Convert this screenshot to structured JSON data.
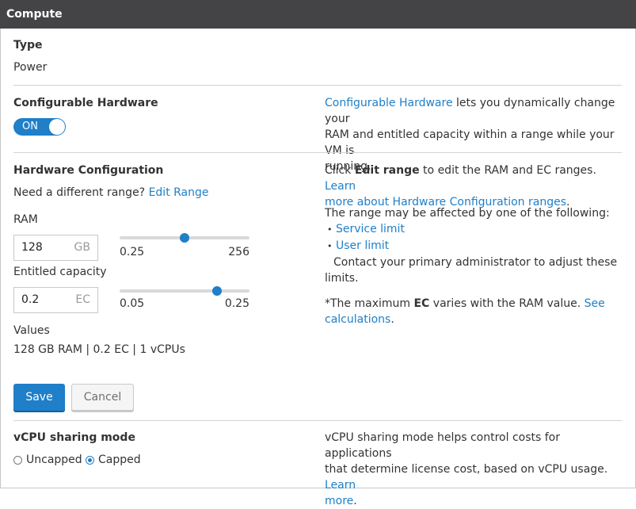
{
  "header": {
    "title": "Compute"
  },
  "type_section": {
    "label": "Type",
    "value": "Power"
  },
  "configurable": {
    "label": "Configurable Hardware",
    "toggle_label": "ON",
    "toggle_on": true,
    "desc_link": "Configurable Hardware",
    "desc_line1": " lets you dynamically change your",
    "desc_line2": "RAM and entitled capacity within a range while your VM is",
    "desc_line3": "running."
  },
  "hardware": {
    "label": "Hardware Configuration",
    "need_text": "Need a different range?",
    "edit_link": "Edit Range",
    "ram_label": "RAM",
    "ram_value": "128",
    "ram_unit": "GB",
    "ram_min": "0.25",
    "ram_max": "256",
    "ram_slider_fraction": 0.5,
    "ec_label": "Entitled capacity",
    "ec_value": "0.2",
    "ec_unit": "EC",
    "ec_min": "0.05",
    "ec_max": "0.25",
    "ec_slider_fraction": 0.75,
    "values_label": "Values",
    "values_text": "128 GB RAM | 0.2 EC | 1 vCPUs",
    "help": {
      "click_text": "Click ",
      "edit_range_bold": "Edit range",
      "click_rest": " to edit the RAM and EC ranges. ",
      "learn_link_1": "Learn",
      "learn_link_2": "more about Hardware Configuration ranges",
      "period": ".",
      "range_text": "The range may be affected by one of the following:",
      "bullet": "•",
      "service_limit": "Service limit",
      "user_limit": "User limit",
      "contact_line1": "Contact your primary administrator to adjust these",
      "contact_line2": "limits.",
      "max_text": "*The maximum ",
      "max_bold": "EC",
      "max_rest": " varies with the RAM value. ",
      "see_link": "See",
      "calc_link": "calculations",
      "calc_period": "."
    }
  },
  "actions": {
    "save": "Save",
    "cancel": "Cancel"
  },
  "vcpu": {
    "label": "vCPU sharing mode",
    "options": [
      "Uncapped",
      "Capped"
    ],
    "selected": "Capped",
    "desc_line1": "vCPU sharing mode helps control costs for applications",
    "desc_line2a": "that determine license cost, based on vCPU usage. ",
    "learn_link_1": "Learn",
    "learn_link_2": "more",
    "period": "."
  },
  "colors": {
    "accent": "#1f7fc8",
    "header_bg": "#444446",
    "divider": "#d4d4d4"
  }
}
